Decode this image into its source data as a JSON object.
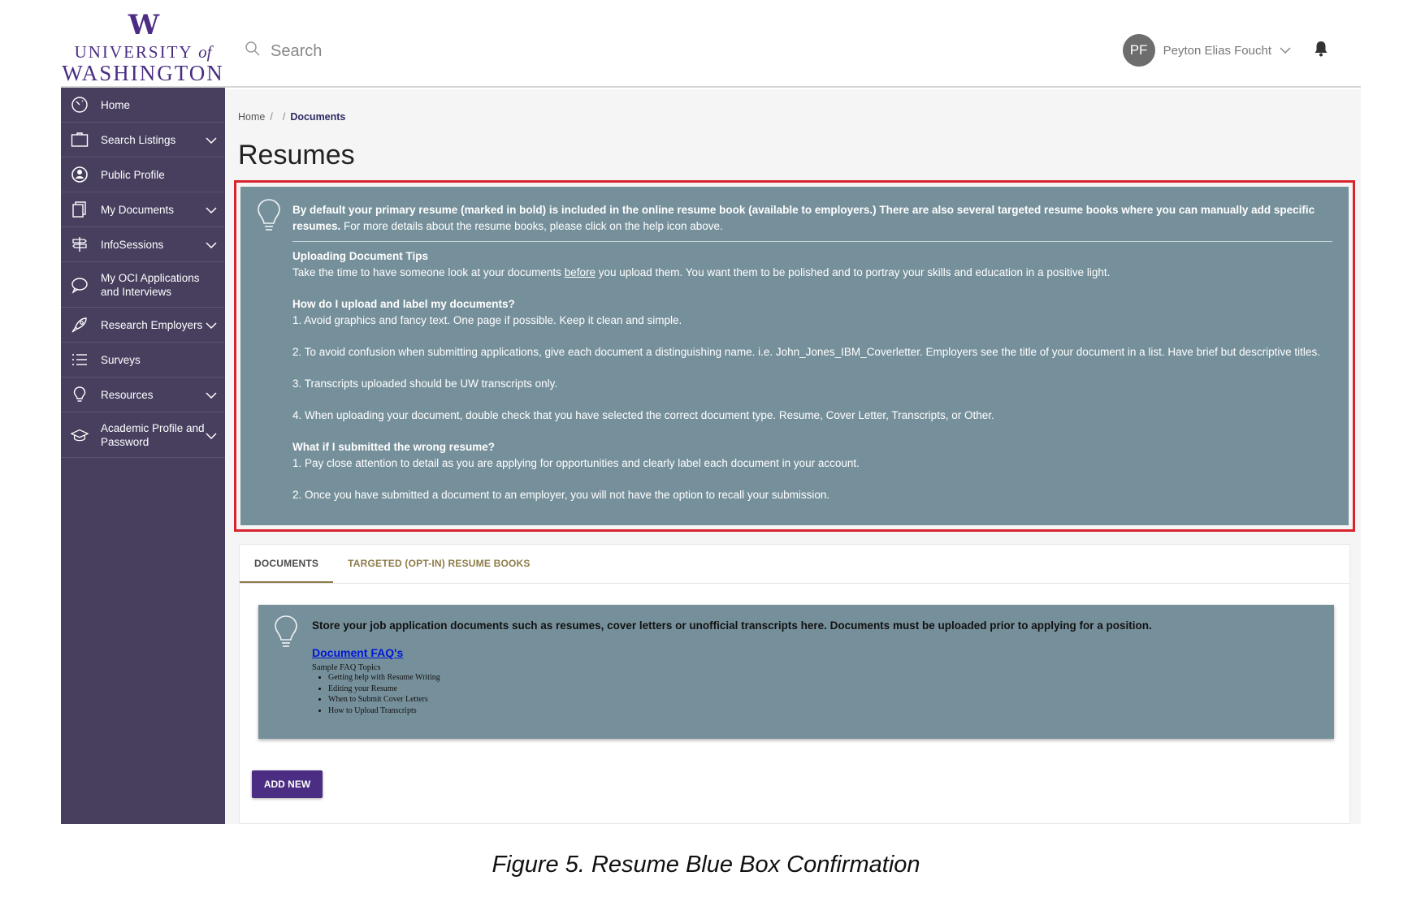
{
  "header": {
    "logo": {
      "mark": "W",
      "line1": "UNIVERSITY",
      "line1_of": "of",
      "line2": "WASHINGTON"
    },
    "search_placeholder": "Search",
    "user": {
      "initials": "PF",
      "name": "Peyton Elias Foucht"
    }
  },
  "sidebar": {
    "items": [
      {
        "label": "Home",
        "icon": "speedometer-icon"
      },
      {
        "label": "Search Listings",
        "icon": "briefcase-icon"
      },
      {
        "label": "Public Profile",
        "icon": "profile-icon"
      },
      {
        "label": "My Documents",
        "icon": "documents-icon"
      },
      {
        "label": "InfoSessions",
        "icon": "signpost-icon"
      },
      {
        "label": "My OCI Applications and Interviews",
        "icon": "chat-icon"
      },
      {
        "label": "Research Employers",
        "icon": "rocket-icon"
      },
      {
        "label": "Surveys",
        "icon": "list-icon"
      },
      {
        "label": "Resources",
        "icon": "lightbulb-icon"
      },
      {
        "label": "Academic Profile and Password",
        "icon": "graduation-cap-icon"
      }
    ]
  },
  "breadcrumb": {
    "home": "Home",
    "sep1": "/",
    "sep2": "/",
    "current": "Documents"
  },
  "page_title": "Resumes",
  "notice": {
    "intro_bold": "By default your primary resume (marked in bold) is included in the online resume book (available to employers.) There are also several targeted resume books where you can manually add specific resumes.",
    "intro_rest": " For more details about the resume books, please click on the help icon above.",
    "tips_heading": "Uploading Document Tips",
    "tips_pre": "Take the time to have someone look at your documents ",
    "tips_under": "before",
    "tips_post": " you upload them. You want them to be polished and to portray your skills and education in a positive light.",
    "upload_heading": "How do I upload and label my documents?",
    "upload_1": "1. Avoid graphics and fancy text. One page if possible. Keep it clean and simple.",
    "upload_2": "2. To avoid confusion when submitting applications, give each document a distinguishing name. i.e. John_Jones_IBM_Coverletter. Employers see the title of your document in a list. Have brief but descriptive titles.",
    "upload_3": "3. Transcripts uploaded should be UW transcripts only.",
    "upload_4": "4. When uploading your document, double check that you have selected the correct document type. Resume, Cover Letter, Transcripts, or Other.",
    "wrong_heading": "What if I submitted the wrong resume?",
    "wrong_1": "1. Pay close attention to detail as you are applying for opportunities and clearly label each document in your account.",
    "wrong_2": "2. Once you have submitted a document to an employer, you will not have the option to recall your submission."
  },
  "tabs": {
    "documents": "DOCUMENTS",
    "targeted": "TARGETED (OPT-IN) RESUME BOOKS"
  },
  "info": {
    "lead": "Store your job application documents such as resumes, cover letters or unofficial transcripts here. Documents must be uploaded prior to applying for a position.",
    "faq_link": "Document FAQ's",
    "sample_label": "Sample FAQ Topics",
    "topics": [
      "Getting help with Resume Writing",
      "Editing your Resume",
      "When to Submit Cover Letters",
      "How to Upload Transcripts"
    ]
  },
  "add_button": "ADD NEW",
  "caption": "Figure 5. Resume Blue Box Confirmation",
  "colors": {
    "uw_purple": "#4b2e83",
    "sidebar": "#483f5f",
    "notice_bg": "#76909b",
    "highlight_border": "#d9232e",
    "tab_gold": "#8d7b49"
  }
}
